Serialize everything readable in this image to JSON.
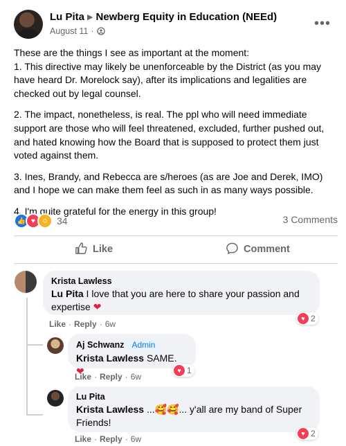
{
  "post": {
    "author": "Lu Pita",
    "group": "Newberg Equity in Education (NEEd)",
    "date": "August 11",
    "paragraphs": [
      "These are the things I see as important at the moment:",
      "1. This directive may likely be unenforceable by the District (as you may have heard Dr. Morelock say), after its implications and legalities are checked out by legal counsel.",
      "2. The impact, nonetheless, is real. The ppl who will need immediate support are those who will feel threatened, excluded, further pushed out, and hated knowing how the Board that is supposed to protect them just voted against them.",
      "3. Ines, Brandy, and Rebecca are s/heroes (as are Joe and Derek, IMO) and I hope we can make them feel as such in as many ways possible.",
      "4. I'm quite grateful for the energy in this group!"
    ],
    "reaction_count": "34",
    "comments_label": "3 Comments"
  },
  "actions": {
    "like_label": "Like",
    "comment_label": "Comment"
  },
  "comments": [
    {
      "author": "Krista Lawless",
      "mention": "Lu Pita",
      "text": " I love that you are here to share your passion and expertise ",
      "emoji": "❤",
      "like": "Like",
      "reply": "Reply",
      "time": "6w",
      "reactions": "2"
    },
    {
      "author": "Aj Schwanz",
      "badge": "Admin",
      "mention": "Krista Lawless",
      "text": " SAME. ",
      "emoji": "❤",
      "like": "Like",
      "reply": "Reply",
      "time": "6w",
      "reactions": "1"
    },
    {
      "author": "Lu Pita",
      "mention": "Krista Lawless",
      "text_line1": " ...🥰🥰... y'all are my band of Super",
      "text_line2": "Friends!",
      "like": "Like",
      "reply": "Reply",
      "time": "6w",
      "reactions": "2"
    }
  ],
  "colors": {
    "accent": "#1b74e4",
    "love": "#f33e58",
    "bubble": "#f0f2f5",
    "muted": "#65676b"
  }
}
